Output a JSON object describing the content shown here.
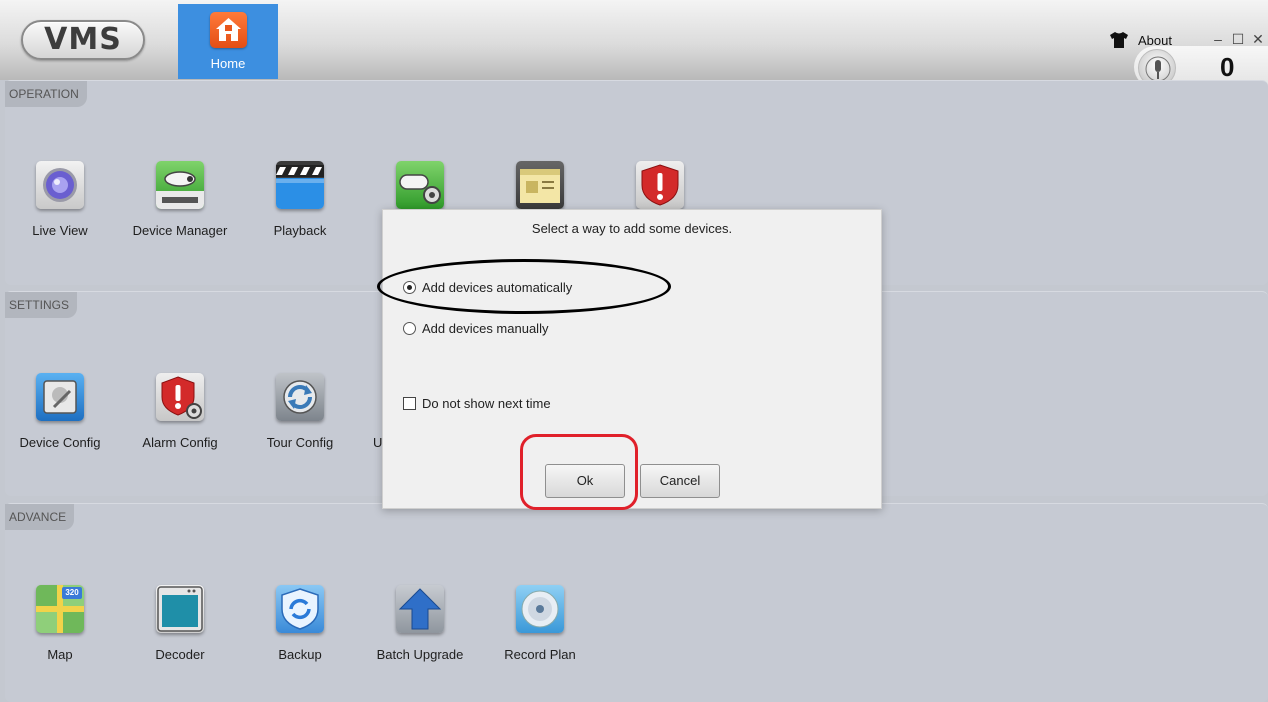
{
  "app": {
    "logo_text": "VMS",
    "home_tab_label": "Home",
    "about_label": "About",
    "window_controls": {
      "minimize": "–",
      "maximize": "☐",
      "close": "✕"
    },
    "counter_value": "0"
  },
  "sections": {
    "operation": {
      "label": "OPERATION",
      "items": [
        {
          "label": "Live View",
          "icon": "live-view-icon"
        },
        {
          "label": "Device Manager",
          "icon": "device-manager-icon"
        },
        {
          "label": "Playback",
          "icon": "playback-icon"
        },
        {
          "label": "",
          "icon": "camera-settings-icon"
        },
        {
          "label": "",
          "icon": "log-icon"
        },
        {
          "label": "",
          "icon": "alarm-icon"
        }
      ]
    },
    "settings": {
      "label": "SETTINGS",
      "items": [
        {
          "label": "Device Config",
          "icon": "device-config-icon"
        },
        {
          "label": "Alarm Config",
          "icon": "alarm-config-icon"
        },
        {
          "label": "Tour Config",
          "icon": "tour-config-icon"
        },
        {
          "label": "U",
          "icon": "user-icon"
        }
      ]
    },
    "advance": {
      "label": "ADVANCE",
      "items": [
        {
          "label": "Map",
          "icon": "map-icon"
        },
        {
          "label": "Decoder",
          "icon": "decoder-icon"
        },
        {
          "label": "Backup",
          "icon": "backup-icon"
        },
        {
          "label": "Batch Upgrade",
          "icon": "batch-upgrade-icon"
        },
        {
          "label": "Record Plan",
          "icon": "record-plan-icon"
        }
      ]
    }
  },
  "map_badge": "320",
  "dialog": {
    "prompt": "Select a way to add some devices.",
    "option_auto": "Add devices automatically",
    "option_manual": "Add devices manually",
    "selected": "auto",
    "checkbox_label": "Do not show next time",
    "checkbox_checked": false,
    "ok_label": "Ok",
    "cancel_label": "Cancel"
  },
  "colors": {
    "home_tab": "#3d8fe0",
    "home_icon": "#e8561c",
    "section_bg": "#c6cad3",
    "annotation_ellipse": "#000000",
    "annotation_rect": "#e0202a"
  }
}
